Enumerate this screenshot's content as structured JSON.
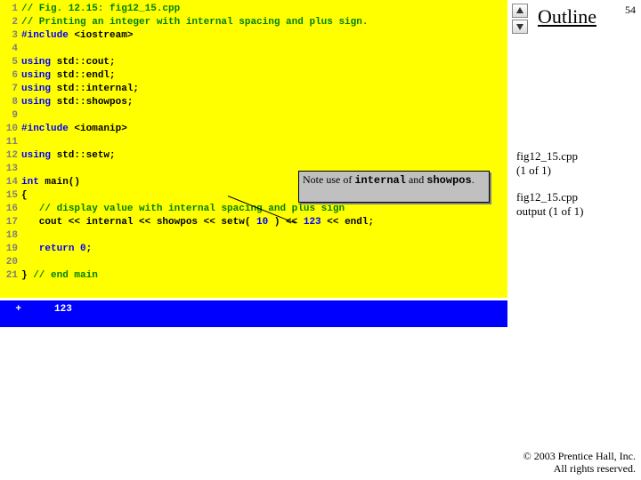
{
  "page_number": "54",
  "outline_title": "Outline",
  "outline_items": [
    "fig12_15.cpp\n(1 of 1)",
    "fig12_15.cpp\noutput (1 of 1)"
  ],
  "nav": {
    "prev": "◀",
    "next": "▶"
  },
  "callout": {
    "prefix": "Note use of ",
    "kw1": "internal",
    "mid": " and ",
    "kw2": "showpos",
    "suffix": "."
  },
  "code": {
    "lines": [
      {
        "n": "1",
        "seg": [
          {
            "c": "comment",
            "t": "// Fig. 12.15: fig12_15.cpp"
          }
        ]
      },
      {
        "n": "2",
        "seg": [
          {
            "c": "comment",
            "t": "// Printing an integer with internal spacing and plus sign."
          }
        ]
      },
      {
        "n": "3",
        "seg": [
          {
            "c": "kw",
            "t": "#include "
          },
          {
            "c": "norm",
            "t": "<iostream>"
          }
        ]
      },
      {
        "n": "4",
        "seg": []
      },
      {
        "n": "5",
        "seg": [
          {
            "c": "kw",
            "t": "using "
          },
          {
            "c": "norm",
            "t": "std::cout;"
          }
        ]
      },
      {
        "n": "6",
        "seg": [
          {
            "c": "kw",
            "t": "using "
          },
          {
            "c": "norm",
            "t": "std::endl;"
          }
        ]
      },
      {
        "n": "7",
        "seg": [
          {
            "c": "kw",
            "t": "using "
          },
          {
            "c": "norm",
            "t": "std::internal;"
          }
        ]
      },
      {
        "n": "8",
        "seg": [
          {
            "c": "kw",
            "t": "using "
          },
          {
            "c": "norm",
            "t": "std::showpos;"
          }
        ]
      },
      {
        "n": "9",
        "seg": []
      },
      {
        "n": "10",
        "seg": [
          {
            "c": "kw",
            "t": "#include "
          },
          {
            "c": "norm",
            "t": "<iomanip>"
          }
        ]
      },
      {
        "n": "11",
        "seg": []
      },
      {
        "n": "12",
        "seg": [
          {
            "c": "kw",
            "t": "using "
          },
          {
            "c": "norm",
            "t": "std::setw;"
          }
        ]
      },
      {
        "n": "13",
        "seg": []
      },
      {
        "n": "14",
        "seg": [
          {
            "c": "kw",
            "t": "int "
          },
          {
            "c": "norm",
            "t": "main()"
          }
        ]
      },
      {
        "n": "15",
        "seg": [
          {
            "c": "norm",
            "t": "{"
          }
        ]
      },
      {
        "n": "16",
        "seg": [
          {
            "c": "norm",
            "t": "   "
          },
          {
            "c": "comment",
            "t": "// display value with internal spacing and plus sign"
          }
        ]
      },
      {
        "n": "17",
        "seg": [
          {
            "c": "norm",
            "t": "   cout << internal << showpos << setw( "
          },
          {
            "c": "kw",
            "t": "10"
          },
          {
            "c": "norm",
            "t": " ) << "
          },
          {
            "c": "kw",
            "t": "123"
          },
          {
            "c": "norm",
            "t": " << endl;"
          }
        ]
      },
      {
        "n": "18",
        "seg": []
      },
      {
        "n": "19",
        "seg": [
          {
            "c": "norm",
            "t": "   "
          },
          {
            "c": "kw",
            "t": "return"
          },
          {
            "c": "norm",
            "t": " "
          },
          {
            "c": "kw",
            "t": "0"
          },
          {
            "c": "norm",
            "t": ";"
          }
        ]
      },
      {
        "n": "20",
        "seg": []
      },
      {
        "n": "21",
        "seg": [
          {
            "c": "norm",
            "t": "} "
          },
          {
            "c": "comment",
            "t": "// end main"
          }
        ]
      }
    ]
  },
  "output": {
    "sign": "+",
    "text": "     123"
  },
  "copyright": "© 2003 Prentice Hall, Inc.\nAll rights reserved."
}
